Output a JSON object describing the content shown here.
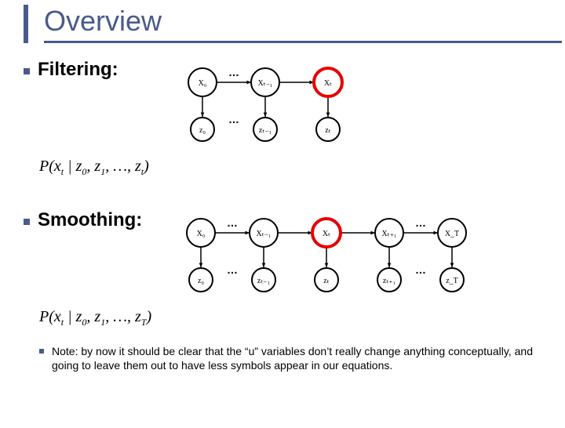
{
  "title": "Overview",
  "sections": {
    "filtering": {
      "label": "Filtering:",
      "formula": "P(x_t | z_0, z_1, …, z_t)"
    },
    "smoothing": {
      "label": "Smoothing:",
      "formula": "P(x_t | z_0, z_1, …, z_T)"
    }
  },
  "note": "Note: by now it should be clear that the “u” variables don’t really change anything conceptually, and going to leave them out to have less symbols appear in our equations.",
  "diagram": {
    "filtering": {
      "x_labels": [
        "X₀",
        "Xₜ₋₁",
        "Xₜ"
      ],
      "z_labels": [
        "z₀",
        "zₜ₋₁",
        "zₜ"
      ],
      "highlight_index": 2
    },
    "smoothing": {
      "x_labels": [
        "X₀",
        "Xₜ₋₁",
        "Xₜ",
        "Xₜ₊₁",
        "X_T"
      ],
      "z_labels": [
        "z₀",
        "zₜ₋₁",
        "zₜ",
        "zₜ₊₁",
        "z_T"
      ],
      "highlight_index": 2
    }
  },
  "chart_data": [
    {
      "type": "diagram",
      "name": "filtering-hmm",
      "title": "Filtering",
      "nodes_top": [
        "X_0",
        "...",
        "X_{t-1}",
        "X_t"
      ],
      "nodes_bottom": [
        "z_0",
        "...",
        "z_{t-1}",
        "z_t"
      ],
      "edges_horizontal_top": [
        [
          "X_0",
          "..."
        ],
        [
          "...",
          "X_{t-1}"
        ],
        [
          "X_{t-1}",
          "X_t"
        ]
      ],
      "edges_vertical": [
        [
          "X_0",
          "z_0"
        ],
        [
          "X_{t-1}",
          "z_{t-1}"
        ],
        [
          "X_t",
          "z_t"
        ]
      ],
      "highlighted": "X_t",
      "highlight_color": "#e60000"
    },
    {
      "type": "diagram",
      "name": "smoothing-hmm",
      "title": "Smoothing",
      "nodes_top": [
        "X_0",
        "...",
        "X_{t-1}",
        "X_t",
        "X_{t+1}",
        "...",
        "X_T"
      ],
      "nodes_bottom": [
        "z_0",
        "...",
        "z_{t-1}",
        "z_t",
        "z_{t+1}",
        "...",
        "z_T"
      ],
      "edges_horizontal_top": [
        [
          "X_0",
          "..."
        ],
        [
          "...",
          "X_{t-1}"
        ],
        [
          "X_{t-1}",
          "X_t"
        ],
        [
          "X_t",
          "X_{t+1}"
        ],
        [
          "X_{t+1}",
          "..."
        ],
        [
          "...",
          "X_T"
        ]
      ],
      "edges_vertical": [
        [
          "X_0",
          "z_0"
        ],
        [
          "X_{t-1}",
          "z_{t-1}"
        ],
        [
          "X_t",
          "z_t"
        ],
        [
          "X_{t+1}",
          "z_{t+1}"
        ],
        [
          "X_T",
          "z_T"
        ]
      ],
      "highlighted": "X_t",
      "highlight_color": "#e60000"
    }
  ]
}
